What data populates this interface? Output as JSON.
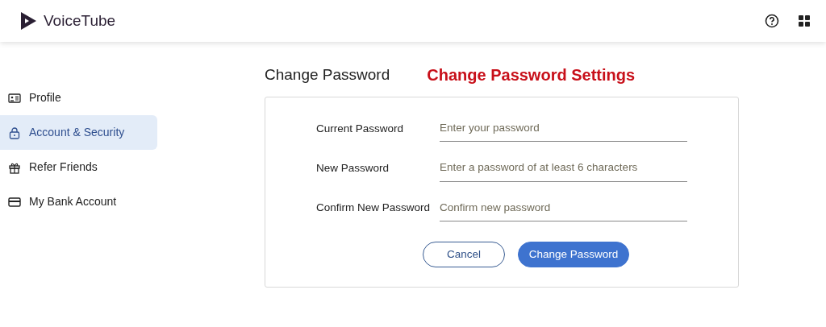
{
  "header": {
    "logo_text": "VoiceTube"
  },
  "sidebar": {
    "items": [
      {
        "label": "Profile",
        "selected": false
      },
      {
        "label": "Account & Security",
        "selected": true
      },
      {
        "label": "Refer Friends",
        "selected": false
      },
      {
        "label": "My Bank Account",
        "selected": false
      }
    ]
  },
  "main": {
    "title": "Change Password",
    "annotation": "Change Password Settings",
    "fields": [
      {
        "label": "Current Password",
        "placeholder": "Enter your password"
      },
      {
        "label": "New Password",
        "placeholder": "Enter a password of at least 6 characters"
      },
      {
        "label": "Confirm New Password",
        "placeholder": "Confirm new password"
      }
    ],
    "buttons": [
      {
        "label": "Cancel",
        "kind": "outline"
      },
      {
        "label": "Change Password",
        "kind": "primary"
      }
    ]
  }
}
